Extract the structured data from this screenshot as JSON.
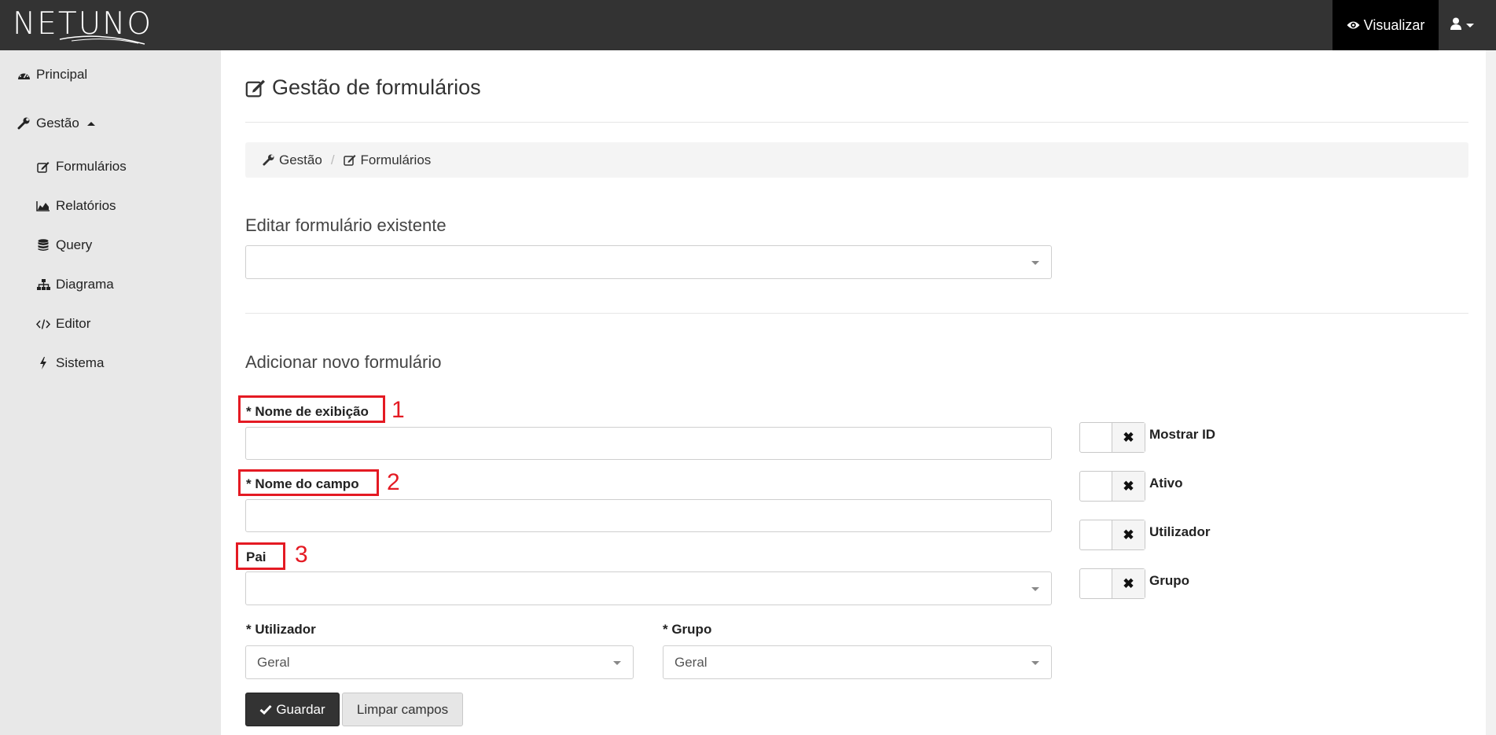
{
  "app": {
    "logo_text": "NETUNO",
    "visualizar_label": "Visualizar",
    "user_icon": "user-icon"
  },
  "sidebar": {
    "items": [
      {
        "label": "Principal",
        "icon": "dashboard-icon"
      },
      {
        "label": "Gestão",
        "icon": "wrench-icon",
        "expanded": true
      },
      {
        "label": "Formulários",
        "icon": "edit-icon"
      },
      {
        "label": "Relatórios",
        "icon": "area-chart-icon"
      },
      {
        "label": "Query",
        "icon": "database-icon"
      },
      {
        "label": "Diagrama",
        "icon": "sitemap-icon"
      },
      {
        "label": "Editor",
        "icon": "code-icon"
      },
      {
        "label": "Sistema",
        "icon": "bolt-icon"
      }
    ]
  },
  "main": {
    "title": "Gestão de formulários",
    "breadcrumb": [
      {
        "label": "Gestão",
        "icon": "wrench-icon"
      },
      {
        "label": "Formulários",
        "icon": "edit-icon"
      }
    ],
    "breadcrumb_separator": "/",
    "edit_section_title": "Editar formulário existente",
    "edit_select_value": "",
    "add_section_title": "Adicionar novo formulário",
    "fields": {
      "display_name_label": "* Nome de exibição",
      "display_name_value": "",
      "field_name_label": "* Nome do campo",
      "field_name_value": "",
      "parent_label": "Pai",
      "parent_value": "",
      "user_label": "* Utilizador",
      "user_value": "Geral",
      "group_label": "* Grupo",
      "group_value": "Geral"
    },
    "toggles": [
      {
        "label": "Mostrar ID",
        "state": "off",
        "symbol": "✖"
      },
      {
        "label": "Ativo",
        "state": "off",
        "symbol": "✖"
      },
      {
        "label": "Utilizador",
        "state": "off",
        "symbol": "✖"
      },
      {
        "label": "Grupo",
        "state": "off",
        "symbol": "✖"
      }
    ],
    "annotations": [
      "1",
      "2",
      "3"
    ],
    "buttons": {
      "save_label": "Guardar",
      "clear_label": "Limpar campos"
    }
  },
  "colors": {
    "topbar": "#333333",
    "sidebar": "#e8e8e8",
    "annotation": "#e41a23",
    "primary_button": "#333333"
  }
}
